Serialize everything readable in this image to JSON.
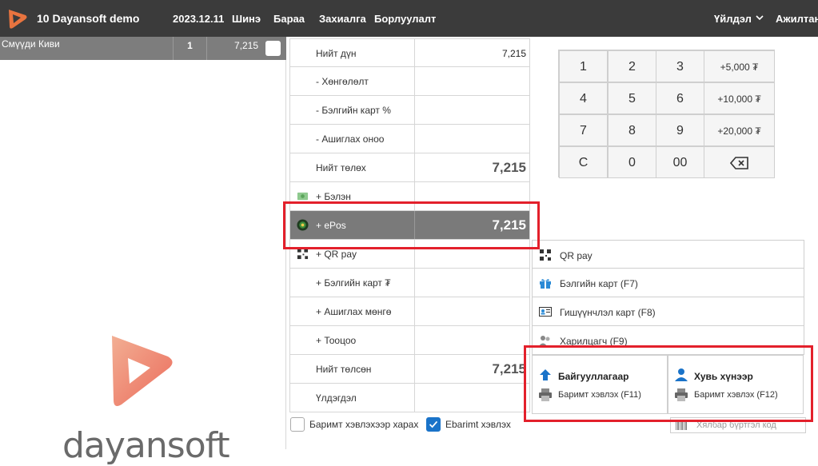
{
  "topbar": {
    "app_title": "10 Dayansoft demo",
    "date": "2023.12.11",
    "menu": [
      "Шинэ",
      "Бараа",
      "Захиалга",
      "Борлуулалт"
    ],
    "operation": "Үйлдэл",
    "user": "Ажилтан"
  },
  "order": {
    "items": [
      {
        "name": "Смүүди Киви",
        "qty": "1",
        "price": "7,215"
      }
    ]
  },
  "brand": {
    "text": "dayansoft"
  },
  "summary": {
    "rows": [
      {
        "label": "Нийт дүн",
        "value": "7,215"
      },
      {
        "label": "- Хөнгөлөлт",
        "value": ""
      },
      {
        "label": "- Бэлгийн карт %",
        "value": ""
      },
      {
        "label": "- Ашиглах оноо",
        "value": ""
      },
      {
        "label": "Нийт төлөх",
        "value": "7,215"
      },
      {
        "label": "+ Бэлэн",
        "value": ""
      },
      {
        "label": "+ ePos",
        "value": "7,215"
      },
      {
        "label": "+ QR pay",
        "value": ""
      },
      {
        "label": "+ Бэлгийн карт ₮",
        "value": ""
      },
      {
        "label": "+ Ашиглах мөнгө",
        "value": ""
      },
      {
        "label": "+ Тооцоо",
        "value": ""
      },
      {
        "label": "Нийт төлсөн",
        "value": "7,215"
      },
      {
        "label": "Үлдэгдэл",
        "value": ""
      }
    ]
  },
  "options": {
    "view_receipt": "Баримт хэвлэхээр харах",
    "ebarimt": "Ebarimt хэвлэх"
  },
  "keypad": {
    "keys": [
      "1",
      "2",
      "3",
      "+5,000 ₮",
      "4",
      "5",
      "6",
      "+10,000 ₮",
      "7",
      "8",
      "9",
      "+20,000 ₮",
      "C",
      "0",
      "00",
      ""
    ]
  },
  "methods": {
    "items": [
      "QR pay",
      "Бэлгийн карт (F7)",
      "Гишүүнчлэл карт (F8)",
      "Харилцагч (F9)"
    ]
  },
  "receipts": {
    "org": {
      "title": "Байгууллагаар",
      "print": "Баримт хэвлэх (F11)"
    },
    "person": {
      "title": "Хувь хүнээр",
      "print": "Баримт хэвлэх (F12)"
    }
  },
  "easy_code": {
    "placeholder": "Хялбар бүртгэл код"
  },
  "colors": {
    "topbar": "#3b3b3b",
    "active_row": "#7a7a7a",
    "highlight": "#e3202b",
    "accent": "#1a73c9"
  }
}
